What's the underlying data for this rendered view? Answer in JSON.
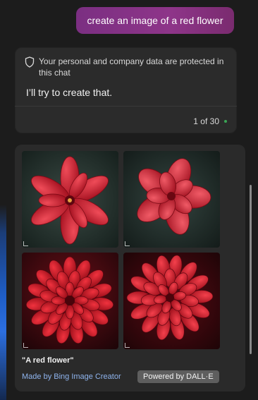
{
  "conversation": {
    "user_message": "create an image of a red flower",
    "privacy_notice": "Your personal and company data are protected in this chat",
    "reply_text": "I’ll try to create that.",
    "counter": "1 of 30"
  },
  "image_result": {
    "caption": "\"A red flower\"",
    "made_by_link": "Made by Bing Image Creator",
    "powered_badge": "Powered by DALL·E"
  },
  "colors": {
    "background": "#1c1c1c",
    "user_bubble": "#8e3589",
    "card": "#2b2b2b",
    "link": "#8fb4ee",
    "status_dot": "#3aa655"
  },
  "icons": {
    "privacy": "shield-icon",
    "status": "status-dot"
  }
}
